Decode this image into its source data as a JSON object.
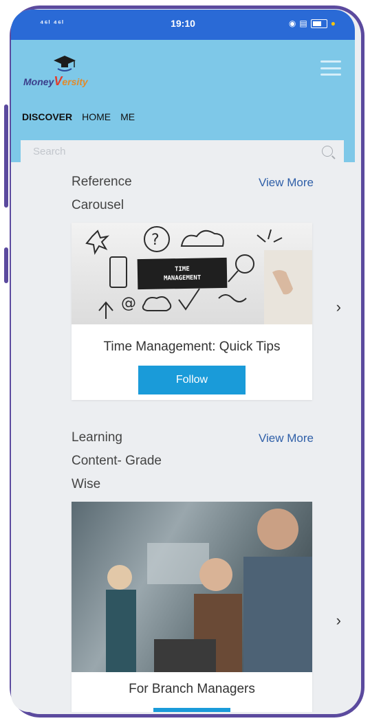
{
  "status_bar": {
    "signal": "⁴⁶ᴵ ⁴⁶ᴵ",
    "time": "19:10"
  },
  "header": {
    "logo": {
      "brand": "Money",
      "brand_v": "V",
      "brand_rest": "ersity"
    },
    "tabs": [
      {
        "label": "DISCOVER",
        "active": true
      },
      {
        "label": "HOME",
        "active": false
      },
      {
        "label": "ME",
        "active": false
      }
    ],
    "search": {
      "placeholder": "Search",
      "value": ""
    }
  },
  "sections": [
    {
      "title_line1": "Reference",
      "title_line2": "Carousel",
      "view_more": "View More",
      "card": {
        "image_label_line1": "TIME",
        "image_label_line2": "MANAGEMENT",
        "title": "Time Management: Quick Tips",
        "button": "Follow"
      }
    },
    {
      "title_line1": "Learning",
      "title_line2": "Content- Grade",
      "title_line3": "Wise",
      "view_more": "View More",
      "card": {
        "title": "For Branch Managers"
      }
    }
  ],
  "colors": {
    "status_bar": "#2a6ad6",
    "header": "#7ec8e8",
    "button": "#1a9bd9",
    "link": "#2f5fa8",
    "frame": "#5b4a9e"
  }
}
